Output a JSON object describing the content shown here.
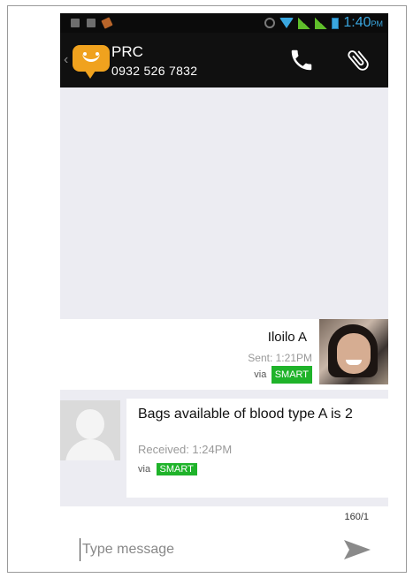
{
  "status_bar": {
    "time": "1:40",
    "ampm": "PM"
  },
  "header": {
    "contact_name": "PRC",
    "contact_number": "0932 526 7832"
  },
  "messages": [
    {
      "direction": "sent",
      "body": "Iloilo A",
      "meta": "Sent: 1:21PM",
      "via_label": "via",
      "carrier": "SMART"
    },
    {
      "direction": "received",
      "body": "Bags available of blood type A is 2",
      "meta": "Received: 1:24PM",
      "via_label": "via",
      "carrier": "SMART"
    }
  ],
  "compose": {
    "counter": "160/1",
    "placeholder": "Type message"
  },
  "colors": {
    "accent_blue": "#3aa7e0",
    "carrier_green": "#1fb32a",
    "logo_orange": "#f0a21e"
  },
  "icons": [
    "alarm-icon",
    "wifi-icon",
    "signal-icon",
    "battery-icon",
    "app-logo-icon",
    "phone-icon",
    "paperclip-icon",
    "send-icon"
  ]
}
